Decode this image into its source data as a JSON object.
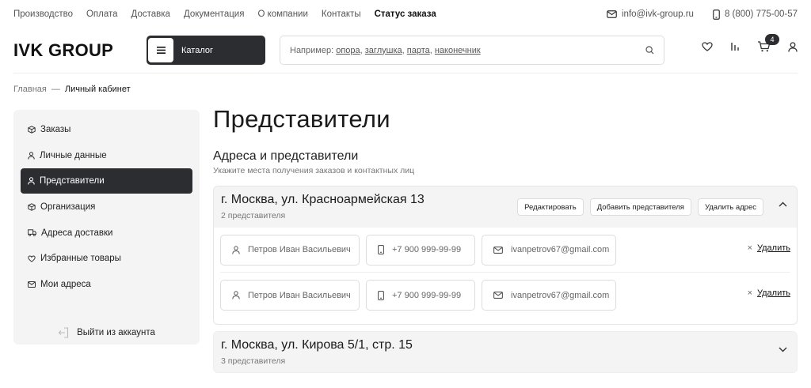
{
  "topnav": {
    "items": [
      "Производство",
      "Оплата",
      "Доставка",
      "Документация",
      "О компании",
      "Контакты"
    ],
    "active": "Статус заказа",
    "email": "info@ivk-group.ru",
    "phone": "8 (800) 775-00-57"
  },
  "header": {
    "logo": "IVK GROUP",
    "catalog_label": "Каталог",
    "search_prefix": "Например: ",
    "search_examples": [
      "опора",
      "заглушка",
      "парта",
      "наконечник"
    ],
    "cart_count": "4"
  },
  "breadcrumb": {
    "home": "Главная",
    "sep": "—",
    "current": "Личный кабинет"
  },
  "sidebar": {
    "items": [
      {
        "label": "Заказы",
        "icon": "box-icon"
      },
      {
        "label": "Личные данные",
        "icon": "user-icon"
      },
      {
        "label": "Представители",
        "icon": "user-icon",
        "active": true
      },
      {
        "label": "Организация",
        "icon": "box-icon"
      },
      {
        "label": "Адреса доставки",
        "icon": "truck-icon"
      },
      {
        "label": "Избранные товары",
        "icon": "heart-icon"
      },
      {
        "label": "Мои адреса",
        "icon": "mail-icon"
      }
    ],
    "logout": "Выйти из аккаунта"
  },
  "main": {
    "title": "Представители",
    "section_title": "Адреса и представители",
    "section_sub": "Укажите места получения заказов и контактных лиц"
  },
  "cards": [
    {
      "title": "г. Москва, ул. Красноармейская 13",
      "count": "2 представителя",
      "actions": [
        "Редактировать",
        "Добавить представителя",
        "Удалить адрес"
      ],
      "expanded": true,
      "reps": [
        {
          "name": "Петров Иван Васильевич",
          "phone": "+7 900 999-99-99",
          "email": "ivanpetrov67@gmail.com"
        },
        {
          "name": "Петров Иван Васильевич",
          "phone": "+7 900 999-99-99",
          "email": "ivanpetrov67@gmail.com"
        }
      ],
      "delete_label": "Удалить"
    },
    {
      "title": "г. Москва, ул. Кирова 5/1, стр. 15",
      "count": "3 представителя",
      "expanded": false
    }
  ]
}
